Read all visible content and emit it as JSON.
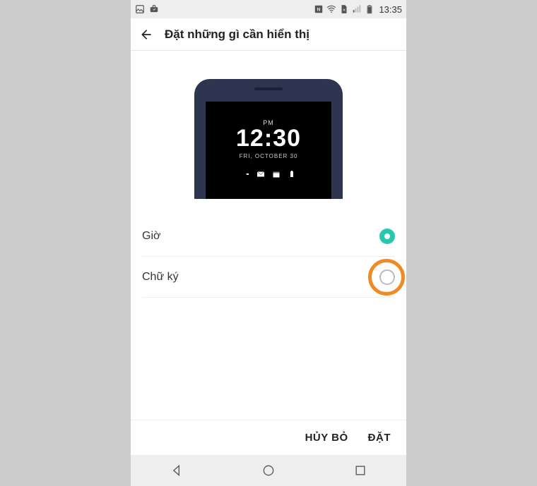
{
  "status_bar": {
    "time": "13:35"
  },
  "header": {
    "title": "Đặt những gì cần hiển thị"
  },
  "preview": {
    "ampm": "PM",
    "clock": "12:30",
    "date": "FRI, OCTOBER 30"
  },
  "options": [
    {
      "label": "Giờ",
      "selected": true
    },
    {
      "label": "Chữ ký",
      "selected": false
    }
  ],
  "footer": {
    "cancel": "HỦY BỎ",
    "set": "ĐẶT"
  }
}
